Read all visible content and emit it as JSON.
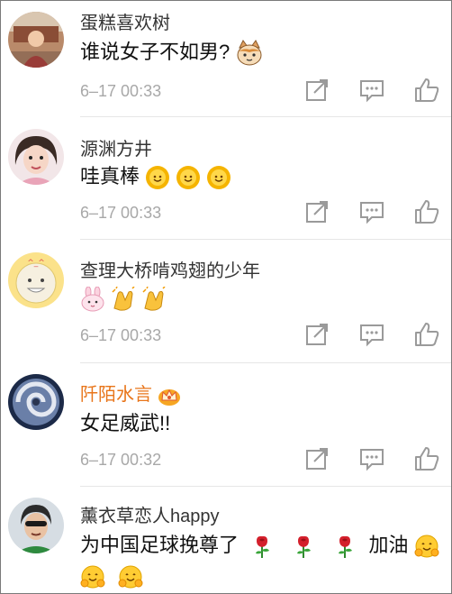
{
  "comments": [
    {
      "username": "蛋糕喜欢树",
      "text": "谁说女子不如男?",
      "emojis": [
        "cat-face"
      ],
      "time": "6–17 00:33"
    },
    {
      "username": "源渊方井",
      "text": "哇真棒",
      "emojis": [
        "smiling-sun",
        "smiling-sun",
        "smiling-sun"
      ],
      "time": "6–17 00:33"
    },
    {
      "username": "查理大桥啃鸡翅的少年",
      "text": "",
      "emojis": [
        "bunny-face",
        "clapping-hands",
        "clapping-hands"
      ],
      "time": "6–17 00:33"
    },
    {
      "username": "阡陌水言",
      "text": "女足威武!!",
      "emojis": [],
      "time": "6–17 00:32",
      "badge": "crown-badge"
    },
    {
      "username": "薰衣草恋人happy",
      "text": "为中国足球挽尊了",
      "text2": "加油",
      "emojis": [
        "rose",
        "rose",
        "rose"
      ],
      "emojis2": [
        "hugging-face"
      ],
      "emojis3": [
        "hugging-face",
        "hugging-face"
      ]
    }
  ],
  "colors": {
    "username": "#333333",
    "vip_username": "#e8751a",
    "time": "#a8a8a8",
    "icon": "#9a9a9a",
    "divider": "#e6e6e6"
  },
  "icons": [
    "repost-icon",
    "comment-icon",
    "like-icon"
  ]
}
